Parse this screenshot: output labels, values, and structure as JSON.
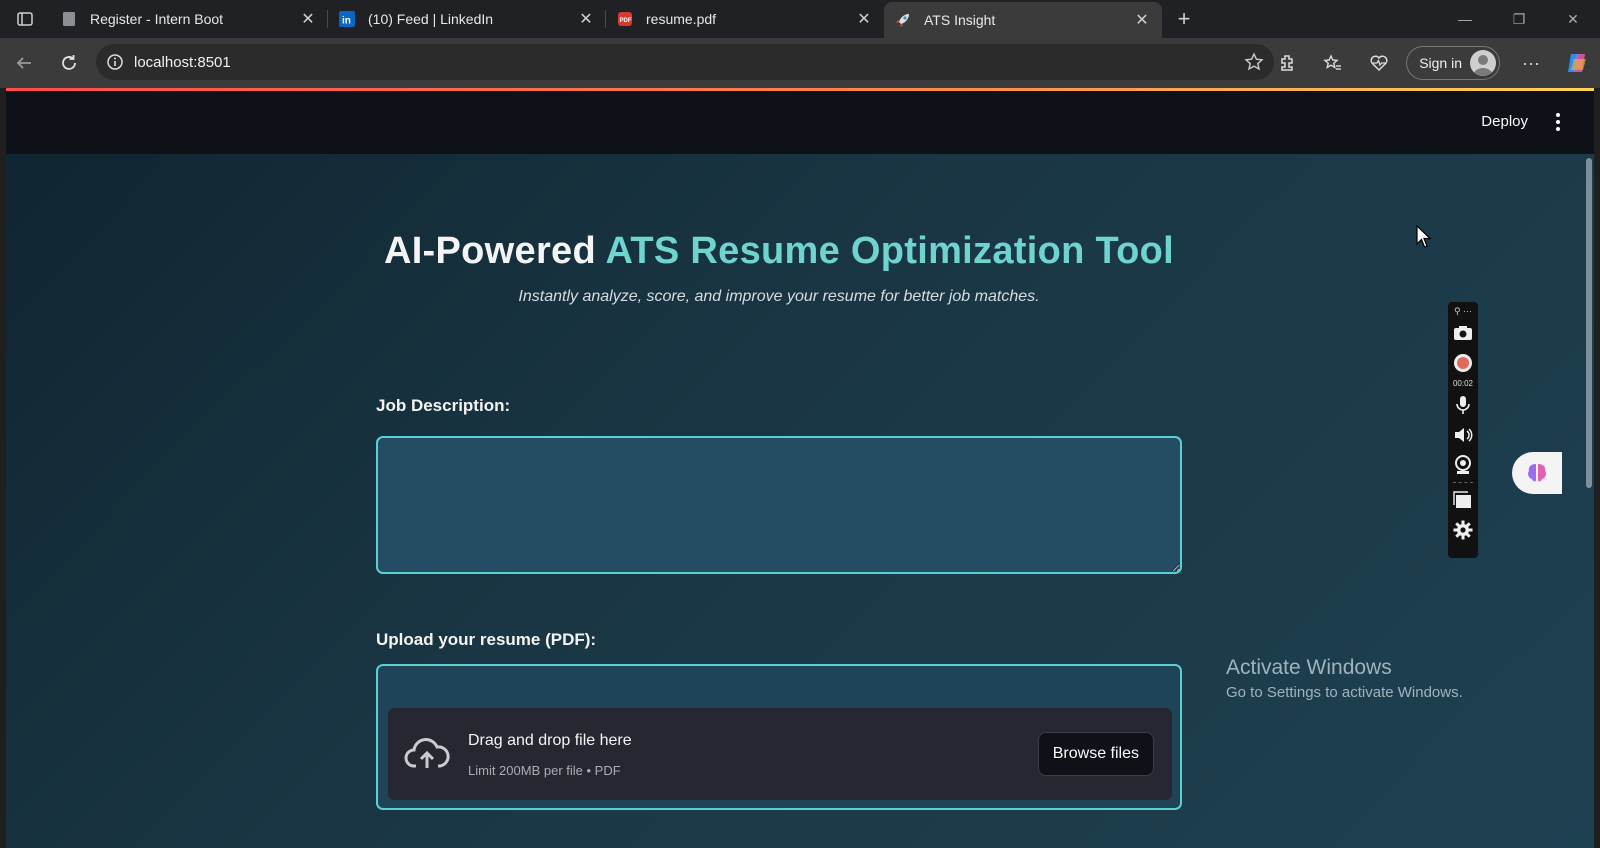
{
  "browser": {
    "tabs": [
      {
        "title": "Register - Intern Boot",
        "favicon": "page-icon"
      },
      {
        "title": "(10) Feed | LinkedIn",
        "favicon": "linkedin-icon"
      },
      {
        "title": "resume.pdf",
        "favicon": "pdf-icon"
      },
      {
        "title": "ATS Insight",
        "favicon": "rocket-icon",
        "active": true
      }
    ],
    "url": "localhost:8501",
    "signin_label": "Sign in"
  },
  "app": {
    "header": {
      "deploy_label": "Deploy"
    },
    "title_part1": "AI-Powered",
    "title_part2": "ATS Resume Optimization Tool",
    "subtitle": "Instantly analyze, score, and improve your resume for better job matches.",
    "job_description": {
      "label": "Job Description:",
      "value": ""
    },
    "upload": {
      "label": "Upload your resume (PDF):",
      "dropzone_title": "Drag and drop file here",
      "dropzone_limit": "Limit 200MB per file • PDF",
      "browse_label": "Browse files"
    }
  },
  "recorder": {
    "timer": "00:02"
  },
  "os_overlay": {
    "activate_title": "Activate Windows",
    "activate_subtitle": "Go to Settings to activate Windows."
  },
  "colors": {
    "accent": "#6fd3cf",
    "border": "#5cd0d0",
    "header_bg": "#0e1117"
  }
}
